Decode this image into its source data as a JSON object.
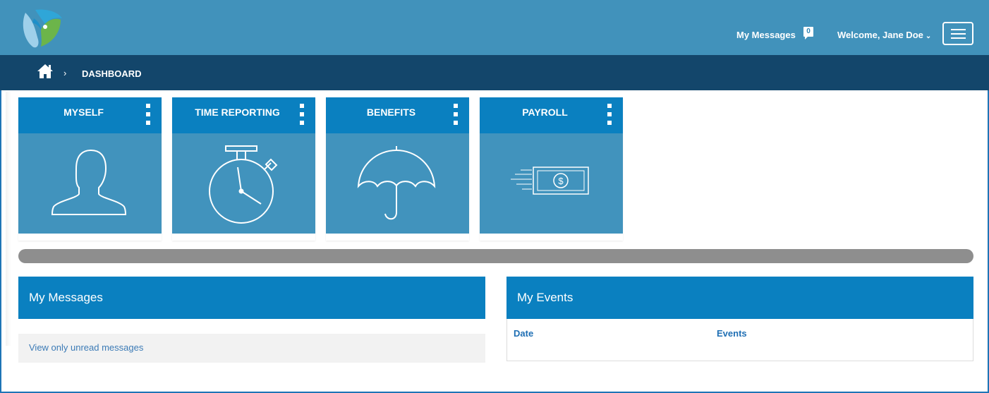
{
  "header": {
    "messages_label": "My Messages",
    "messages_count": "0",
    "welcome_text": "Welcome, Jane Doe",
    "welcome_chevron": "⌄"
  },
  "breadcrumb": {
    "separator": "›",
    "current": "DASHBOARD"
  },
  "tiles": [
    {
      "title": "MYSELF",
      "icon": "person-icon"
    },
    {
      "title": "TIME REPORTING",
      "icon": "stopwatch-icon"
    },
    {
      "title": "BENEFITS",
      "icon": "umbrella-icon"
    },
    {
      "title": "PAYROLL",
      "icon": "money-icon"
    }
  ],
  "panels": {
    "messages": {
      "title": "My Messages",
      "link": "View only unread messages"
    },
    "events": {
      "title": "My Events",
      "columns": [
        "Date",
        "Events"
      ]
    }
  },
  "colors": {
    "header": "#4192bb",
    "breadcrumb_bar": "#13466b",
    "tile_header": "#0a80c0",
    "tile_body": "#4193bd",
    "link": "#3c7bb6"
  }
}
